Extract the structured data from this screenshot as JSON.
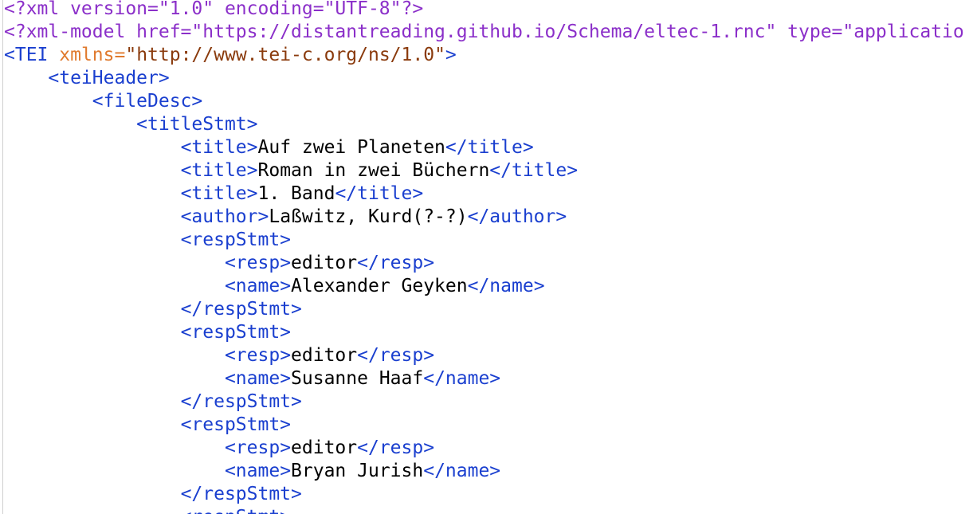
{
  "colors": {
    "processing_instruction": "#8b2fc9",
    "tag": "#1a3fcf",
    "attribute_name": "#e07a2e",
    "attribute_value": "#8a3a0c",
    "text": "#000000",
    "background": "#ffffff"
  },
  "lines": [
    [
      {
        "k": "pi",
        "t": "<?xml version=\"1.0\" encoding=\"UTF-8\"?>"
      }
    ],
    [
      {
        "k": "pi",
        "t": "<?xml-model href=\"https://distantreading.github.io/Schema/eltec-1.rnc\" type=\"applicatio"
      }
    ],
    [
      {
        "k": "tag",
        "t": "<TEI "
      },
      {
        "k": "attr",
        "t": "xmlns="
      },
      {
        "k": "val",
        "t": "\"http://www.tei-c.org/ns/1.0\""
      },
      {
        "k": "tag",
        "t": ">"
      }
    ],
    [
      {
        "k": "txt",
        "t": "    "
      },
      {
        "k": "tag",
        "t": "<teiHeader>"
      }
    ],
    [
      {
        "k": "txt",
        "t": "        "
      },
      {
        "k": "tag",
        "t": "<fileDesc>"
      }
    ],
    [
      {
        "k": "txt",
        "t": "            "
      },
      {
        "k": "tag",
        "t": "<titleStmt>"
      }
    ],
    [
      {
        "k": "txt",
        "t": "                "
      },
      {
        "k": "tag",
        "t": "<title>"
      },
      {
        "k": "txt",
        "t": "Auf zwei Planeten"
      },
      {
        "k": "tag",
        "t": "</title>"
      }
    ],
    [
      {
        "k": "txt",
        "t": "                "
      },
      {
        "k": "tag",
        "t": "<title>"
      },
      {
        "k": "txt",
        "t": "Roman in zwei Büchern"
      },
      {
        "k": "tag",
        "t": "</title>"
      }
    ],
    [
      {
        "k": "txt",
        "t": "                "
      },
      {
        "k": "tag",
        "t": "<title>"
      },
      {
        "k": "txt",
        "t": "1. Band"
      },
      {
        "k": "tag",
        "t": "</title>"
      }
    ],
    [
      {
        "k": "txt",
        "t": "                "
      },
      {
        "k": "tag",
        "t": "<author>"
      },
      {
        "k": "txt",
        "t": "Laßwitz, Kurd(?-?)"
      },
      {
        "k": "tag",
        "t": "</author>"
      }
    ],
    [
      {
        "k": "txt",
        "t": "                "
      },
      {
        "k": "tag",
        "t": "<respStmt>"
      }
    ],
    [
      {
        "k": "txt",
        "t": "                    "
      },
      {
        "k": "tag",
        "t": "<resp>"
      },
      {
        "k": "txt",
        "t": "editor"
      },
      {
        "k": "tag",
        "t": "</resp>"
      }
    ],
    [
      {
        "k": "txt",
        "t": "                    "
      },
      {
        "k": "tag",
        "t": "<name>"
      },
      {
        "k": "txt",
        "t": "Alexander Geyken"
      },
      {
        "k": "tag",
        "t": "</name>"
      }
    ],
    [
      {
        "k": "txt",
        "t": "                "
      },
      {
        "k": "tag",
        "t": "</respStmt>"
      }
    ],
    [
      {
        "k": "txt",
        "t": "                "
      },
      {
        "k": "tag",
        "t": "<respStmt>"
      }
    ],
    [
      {
        "k": "txt",
        "t": "                    "
      },
      {
        "k": "tag",
        "t": "<resp>"
      },
      {
        "k": "txt",
        "t": "editor"
      },
      {
        "k": "tag",
        "t": "</resp>"
      }
    ],
    [
      {
        "k": "txt",
        "t": "                    "
      },
      {
        "k": "tag",
        "t": "<name>"
      },
      {
        "k": "txt",
        "t": "Susanne Haaf"
      },
      {
        "k": "tag",
        "t": "</name>"
      }
    ],
    [
      {
        "k": "txt",
        "t": "                "
      },
      {
        "k": "tag",
        "t": "</respStmt>"
      }
    ],
    [
      {
        "k": "txt",
        "t": "                "
      },
      {
        "k": "tag",
        "t": "<respStmt>"
      }
    ],
    [
      {
        "k": "txt",
        "t": "                    "
      },
      {
        "k": "tag",
        "t": "<resp>"
      },
      {
        "k": "txt",
        "t": "editor"
      },
      {
        "k": "tag",
        "t": "</resp>"
      }
    ],
    [
      {
        "k": "txt",
        "t": "                    "
      },
      {
        "k": "tag",
        "t": "<name>"
      },
      {
        "k": "txt",
        "t": "Bryan Jurish"
      },
      {
        "k": "tag",
        "t": "</name>"
      }
    ],
    [
      {
        "k": "txt",
        "t": "                "
      },
      {
        "k": "tag",
        "t": "</respStmt>"
      }
    ],
    [
      {
        "k": "txt",
        "t": "                "
      },
      {
        "k": "tag",
        "t": "<respStmt>"
      }
    ]
  ]
}
